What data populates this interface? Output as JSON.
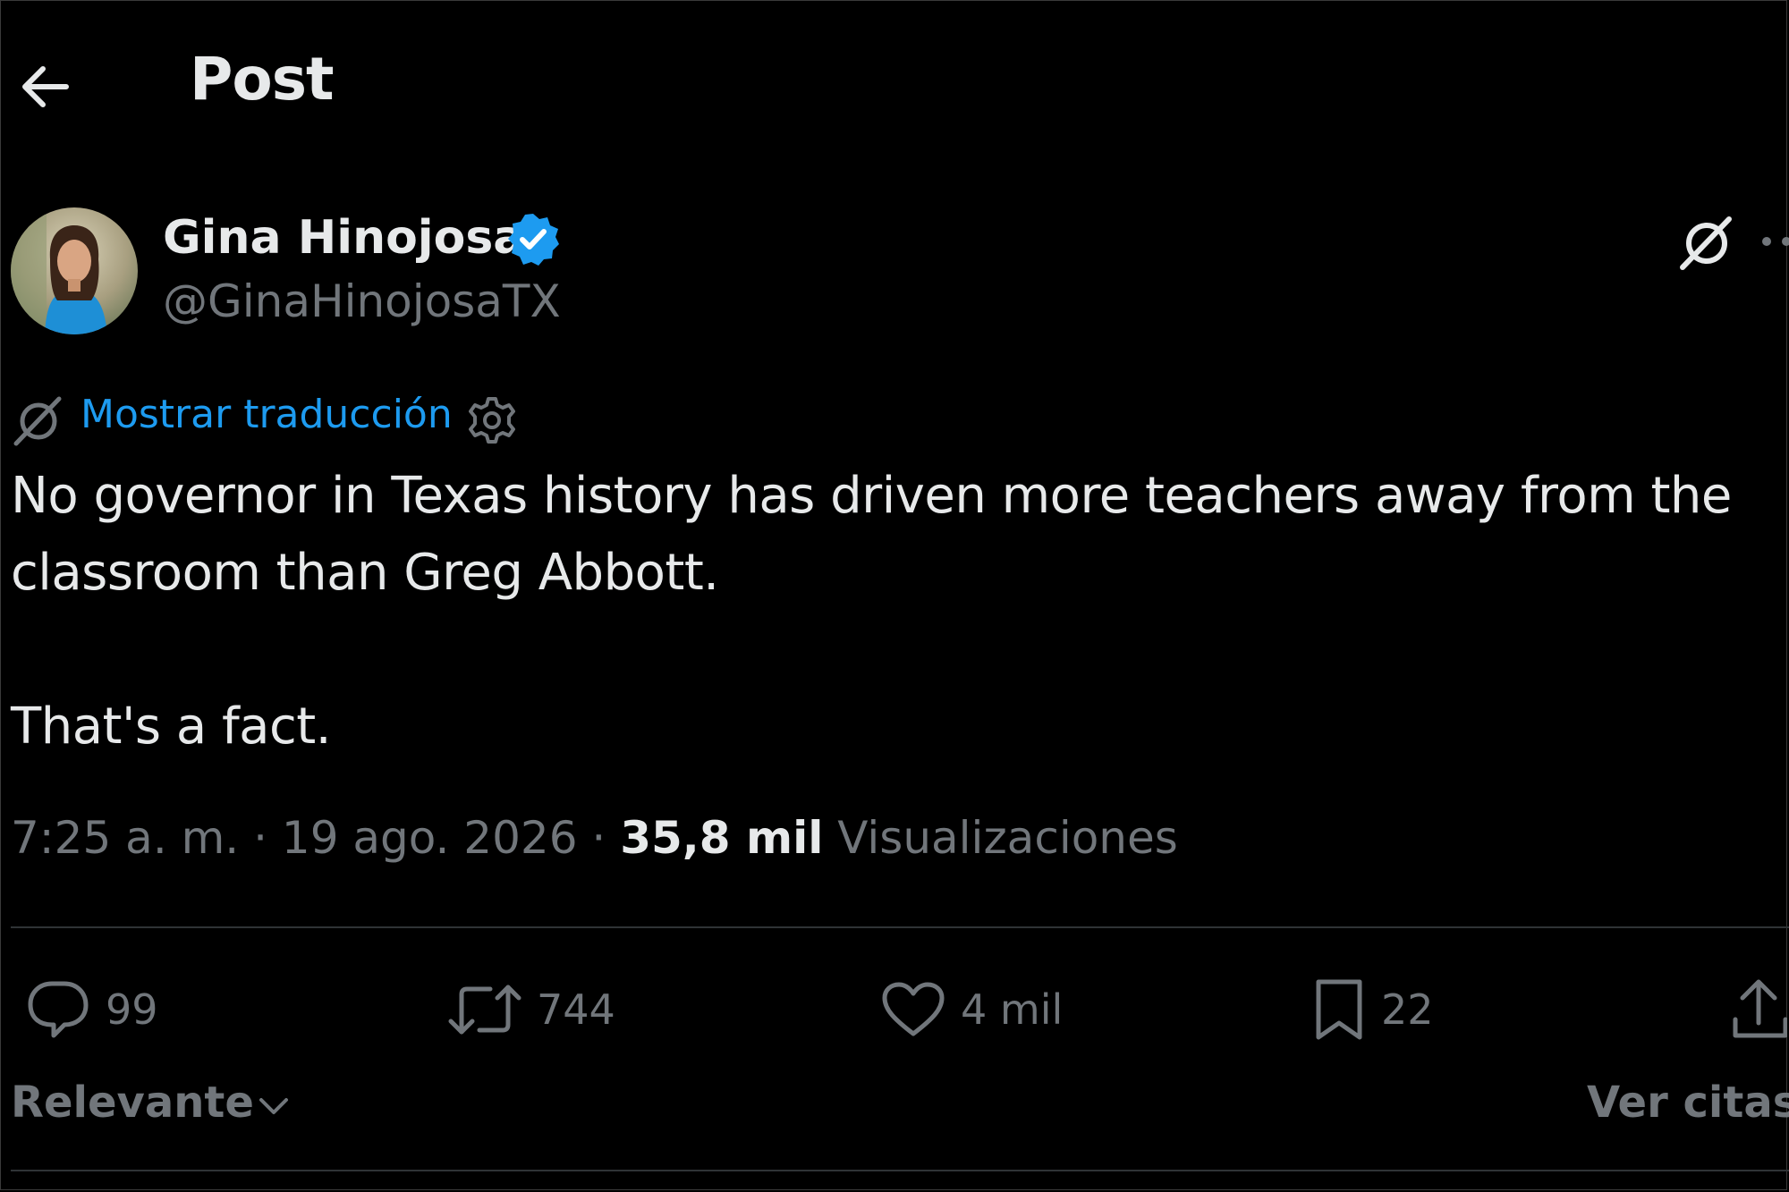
{
  "header": {
    "title": "Post",
    "back_icon": "arrow-left-icon"
  },
  "author": {
    "display_name": "Gina Hinojosa",
    "handle": "@GinaHinojosaTX",
    "verified": true,
    "verified_color": "#1d9bf0"
  },
  "translate": {
    "link_label": "Mostrar traducción",
    "link_color": "#1d9bf0"
  },
  "post": {
    "text": "No governor in Texas history has driven more teachers away from the\nclassroom than Greg Abbott.\n\nThat's a fact."
  },
  "meta": {
    "time": "7:25 a. m.",
    "separator": " · ",
    "date": "19 ago. 2026",
    "views_count": "35,8 mil",
    "views_label": "Visualizaciones"
  },
  "actions": {
    "replies": "99",
    "reposts": "744",
    "likes": "4 mil",
    "bookmarks": "22"
  },
  "bottom": {
    "sort_label": "Relevante",
    "quotes_label": "Ver citas"
  },
  "colors": {
    "background": "#000000",
    "text": "#e7e9ea",
    "muted": "#71767b",
    "accent": "#1d9bf0",
    "divider": "#2f3336"
  }
}
